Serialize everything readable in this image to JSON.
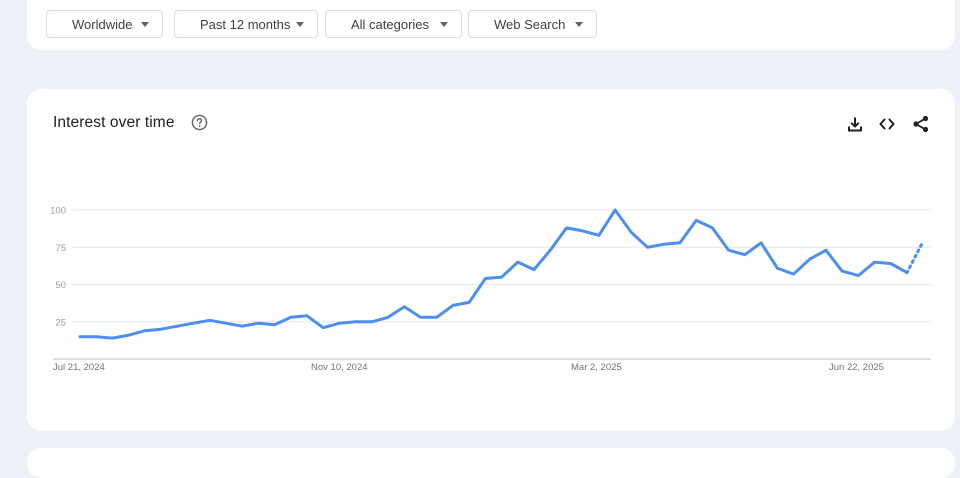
{
  "filters": {
    "region": "Worldwide",
    "time_range": "Past 12 months",
    "category": "All categories",
    "search_type": "Web Search"
  },
  "card": {
    "title": "Interest over time"
  },
  "icons": {
    "help": "help-circle-icon",
    "download": "download-icon",
    "embed": "code-icon",
    "share": "share-icon"
  },
  "colors": {
    "line": "#4d8ff0",
    "grid": "#e6e6e6",
    "background": "#eef1f7"
  },
  "chart_data": {
    "type": "line",
    "title": "Interest over time",
    "xlabel": "",
    "ylabel": "",
    "ylim": [
      0,
      100
    ],
    "y_ticks": [
      25,
      50,
      75,
      100
    ],
    "x_tick_labels": [
      "Jul 21, 2024",
      "Nov 10, 2024",
      "Mar 2, 2025",
      "Jun 22, 2025"
    ],
    "x_start": "2024-07-21",
    "x_end": "2025-07-13",
    "grid": true,
    "legend": "none",
    "series": [
      {
        "dates": [
          "2024-07-21",
          "2024-07-28",
          "2024-08-04",
          "2024-08-11",
          "2024-08-18",
          "2024-08-25",
          "2024-09-01",
          "2024-09-08",
          "2024-09-15",
          "2024-09-22",
          "2024-09-29",
          "2024-10-06",
          "2024-10-13",
          "2024-10-20",
          "2024-10-27",
          "2024-11-03",
          "2024-11-10",
          "2024-11-17",
          "2024-11-24",
          "2024-12-01",
          "2024-12-08",
          "2024-12-15",
          "2024-12-22",
          "2024-12-29",
          "2025-01-05",
          "2025-01-12",
          "2025-01-19",
          "2025-01-26",
          "2025-02-02",
          "2025-02-09",
          "2025-02-16",
          "2025-02-23",
          "2025-03-02",
          "2025-03-09",
          "2025-03-16",
          "2025-03-23",
          "2025-03-30",
          "2025-04-06",
          "2025-04-13",
          "2025-04-20",
          "2025-04-27",
          "2025-05-04",
          "2025-05-11",
          "2025-05-18",
          "2025-05-25",
          "2025-06-01",
          "2025-06-08",
          "2025-06-15",
          "2025-06-22",
          "2025-06-29",
          "2025-07-06",
          "2025-07-13"
        ],
        "values": [
          15,
          15,
          14,
          16,
          19,
          20,
          22,
          24,
          26,
          24,
          22,
          24,
          23,
          28,
          29,
          21,
          24,
          25,
          25,
          28,
          35,
          28,
          28,
          36,
          38,
          54,
          55,
          65,
          60,
          73,
          88,
          86,
          83,
          100,
          85,
          75,
          77,
          78,
          93,
          88,
          73,
          70,
          78,
          61,
          57,
          67,
          73,
          59,
          56,
          65,
          64,
          58
        ],
        "partial": {
          "dates": [
            "2025-07-06",
            "2025-07-13",
            "2025-07-20"
          ],
          "values": [
            64,
            58,
            79
          ]
        }
      }
    ]
  }
}
